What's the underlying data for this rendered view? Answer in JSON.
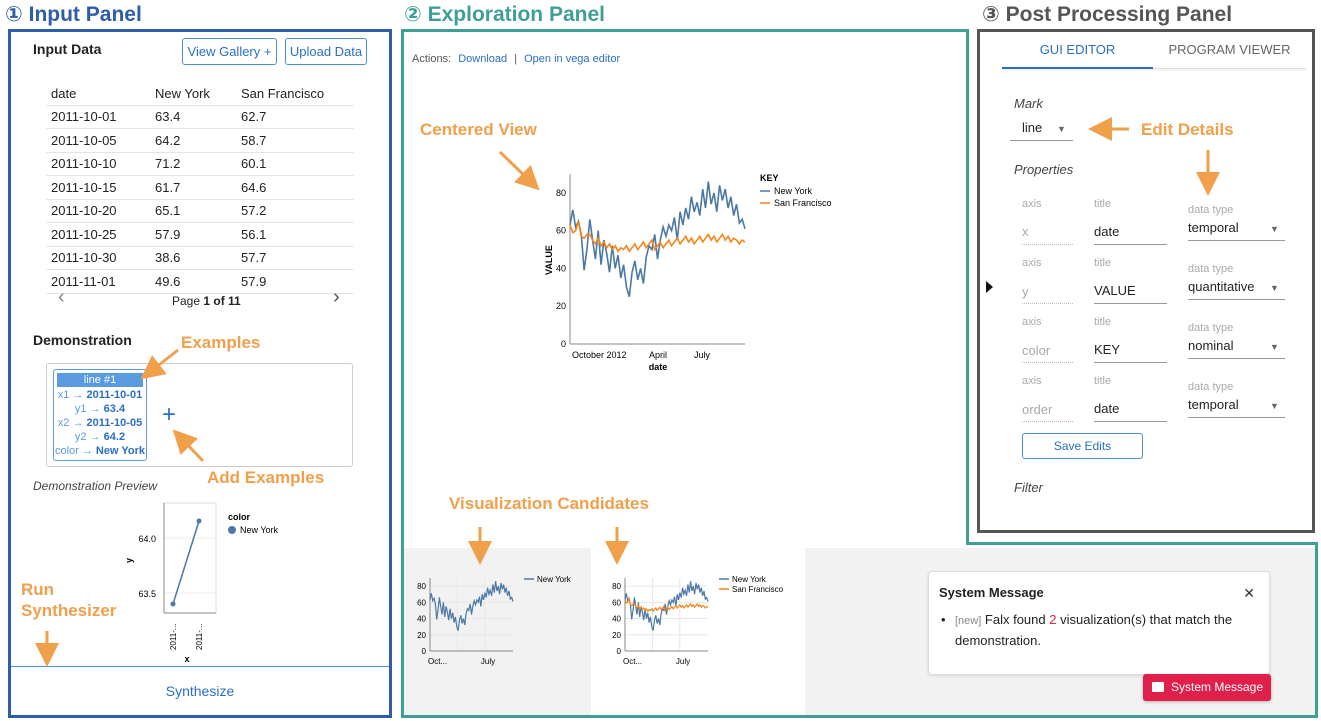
{
  "panels": {
    "input": {
      "title": "① Input Panel",
      "color": "#2e5ea8"
    },
    "exploration": {
      "title": "② Exploration Panel",
      "color": "#3f9f97"
    },
    "post": {
      "title": "③ Post Processing Panel",
      "color": "#555555"
    }
  },
  "input": {
    "heading": "Input Data",
    "view_gallery": "View Gallery +",
    "upload_data": "Upload Data",
    "columns": [
      "date",
      "New York",
      "San Francisco"
    ],
    "rows": [
      [
        "2011-10-01",
        "63.4",
        "62.7"
      ],
      [
        "2011-10-05",
        "64.2",
        "58.7"
      ],
      [
        "2011-10-10",
        "71.2",
        "60.1"
      ],
      [
        "2011-10-15",
        "61.7",
        "64.6"
      ],
      [
        "2011-10-20",
        "65.1",
        "57.2"
      ],
      [
        "2011-10-25",
        "57.9",
        "56.1"
      ],
      [
        "2011-10-30",
        "38.6",
        "57.7"
      ],
      [
        "2011-11-01",
        "49.6",
        "57.9"
      ]
    ],
    "page_prefix": "Page ",
    "page_current": "1 of 11",
    "prev": "‹",
    "next": "›",
    "demo_heading": "Demonstration",
    "example": {
      "header": "line #1",
      "lines": [
        {
          "key": "x1 →",
          "val": "2011-10-01"
        },
        {
          "key": "y1 →",
          "val": "63.4"
        },
        {
          "key": "x2 →",
          "val": "2011-10-05"
        },
        {
          "key": "y2 →",
          "val": "64.2"
        },
        {
          "key": "color →",
          "val": "New York"
        }
      ]
    },
    "plus": "+",
    "preview_label": "Demonstration Preview",
    "preview_chart": {
      "legend_title": "color",
      "legend_item": "New York",
      "ylabel": "y",
      "xlabel": "x",
      "yticks": [
        "64.0",
        "63.5"
      ],
      "xticks": [
        "2011-...",
        "2011-..."
      ]
    },
    "synthesize": "Synthesize"
  },
  "exploration": {
    "actions_label": "Actions:",
    "download": "Download",
    "sep": "|",
    "open_vega": "Open in vega editor",
    "candidate2_legend": [
      "New York",
      "San Francisco"
    ],
    "candidate1_legend": [
      "New York"
    ],
    "candidate_xticks": [
      "Oct...",
      "July"
    ]
  },
  "system_message": {
    "title": "System Message",
    "close": "✕",
    "new_tag": "[new]",
    "text_before": "Falx found ",
    "count": "2",
    "text_after": " visualization(s) that match the demonstration.",
    "button": "System Message"
  },
  "post": {
    "tab_gui": "GUI EDITOR",
    "tab_program": "PROGRAM VIEWER",
    "mark_label": "Mark",
    "mark_value": "line",
    "properties_label": "Properties",
    "props": [
      {
        "axis_label": "axis",
        "axis": "x",
        "title_label": "title",
        "title": "date",
        "type_label": "data type",
        "type": "temporal"
      },
      {
        "axis_label": "axis",
        "axis": "y",
        "title_label": "title",
        "title": "VALUE",
        "type_label": "data type",
        "type": "quantitative"
      },
      {
        "axis_label": "axis",
        "axis": "color",
        "title_label": "title",
        "title": "KEY",
        "type_label": "data type",
        "type": "nominal"
      },
      {
        "axis_label": "axis",
        "axis": "order",
        "title_label": "title",
        "title": "date",
        "type_label": "data type",
        "type": "temporal"
      }
    ],
    "save_edits": "Save Edits",
    "filter_label": "Filter"
  },
  "annotations": {
    "examples": "Examples",
    "add_examples": "Add Examples",
    "run_synth_1": "Run",
    "run_synth_2": "Synthesizer",
    "centered_view": "Centered View",
    "vis_candidates": "Visualization Candidates",
    "edit_details": "Edit Details"
  },
  "chart_data": [
    {
      "type": "line",
      "title": "",
      "xlabel": "date",
      "ylabel": "VALUE",
      "x_ticks": [
        "October 2012",
        "April",
        "July"
      ],
      "y_ticks": [
        0,
        20,
        40,
        60,
        80
      ],
      "ylim": [
        0,
        90
      ],
      "legend_title": "KEY",
      "legend_position": "top-right",
      "series": [
        {
          "name": "New York",
          "color": "#4c78a8",
          "values": [
            63,
            71,
            62,
            65,
            58,
            39,
            50,
            66,
            55,
            45,
            60,
            42,
            55,
            48,
            38,
            52,
            40,
            47,
            35,
            42,
            30,
            25,
            38,
            44,
            34,
            40,
            32,
            46,
            52,
            50,
            58,
            45,
            55,
            62,
            57,
            63,
            60,
            67,
            55,
            70,
            63,
            72,
            66,
            78,
            70,
            75,
            68,
            82,
            72,
            86,
            74,
            80,
            70,
            84,
            76,
            82,
            72,
            78,
            68,
            74,
            64,
            66,
            61
          ]
        },
        {
          "name": "San Francisco",
          "color": "#f58518",
          "values": [
            63,
            59,
            60,
            65,
            57,
            56,
            58,
            58,
            55,
            53,
            56,
            52,
            54,
            51,
            53,
            50,
            52,
            49,
            51,
            50,
            52,
            49,
            51,
            53,
            50,
            52,
            54,
            51,
            53,
            55,
            50,
            52,
            54,
            51,
            53,
            55,
            52,
            54,
            56,
            53,
            55,
            57,
            54,
            56,
            53,
            55,
            57,
            54,
            56,
            58,
            55,
            57,
            54,
            56,
            58,
            55,
            57,
            54,
            56,
            55,
            53,
            55,
            54
          ]
        }
      ]
    }
  ]
}
